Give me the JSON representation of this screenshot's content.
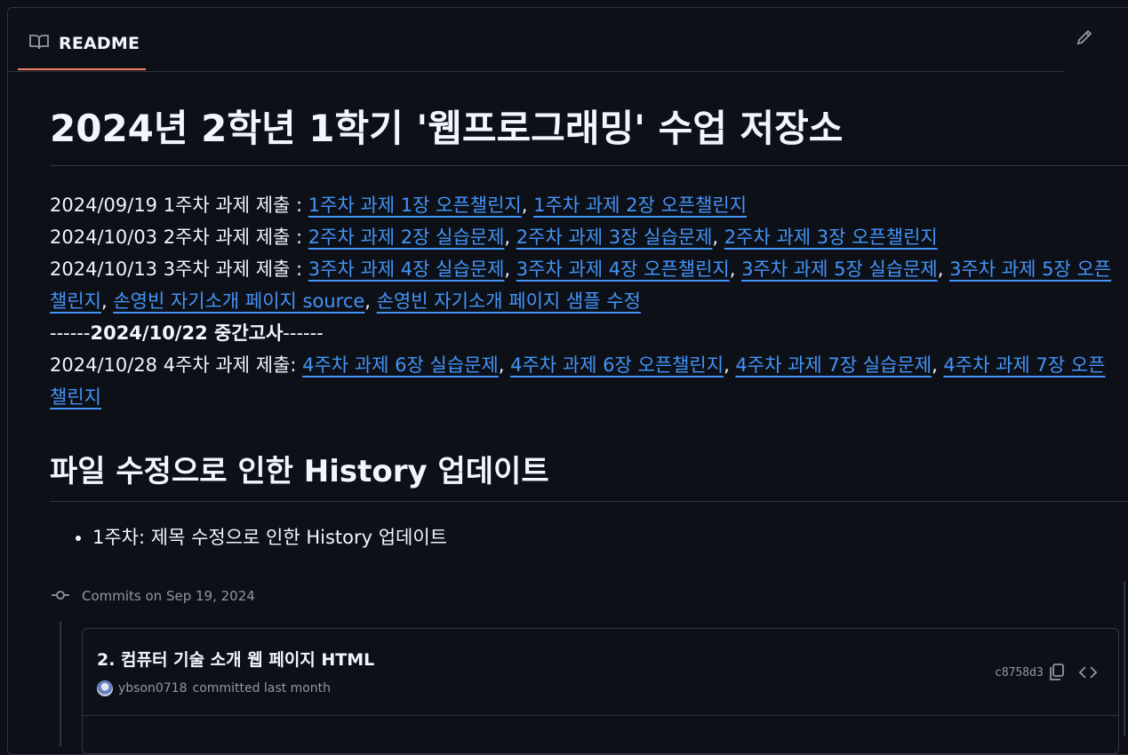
{
  "readme_tab": {
    "label": "README",
    "icon": "book-icon"
  },
  "toolbar": {
    "edit_icon": "pencil-icon",
    "more_icon": "kebab-icon"
  },
  "title": "2024년 2학년 1학기 '웹프로그래밍' 수업 저장소",
  "schedule": {
    "week1": {
      "prefix": "2024/09/19 1주차 과제 제출 : ",
      "links": [
        "1주차 과제 1장 오픈챌린지",
        "1주차 과제 2장 오픈챌린지"
      ]
    },
    "week2": {
      "prefix": "2024/10/03 2주차 과제 제출 : ",
      "links": [
        "2주차 과제 2장 실습문제",
        "2주차 과제 3장 실습문제",
        "2주차 과제 3장 오픈챌린지"
      ]
    },
    "week3": {
      "prefix": "2024/10/13 3주차 과제 제출 : ",
      "links": [
        "3주차 과제 4장 실습문제",
        "3주차 과제 4장 오픈챌린지",
        "3주차 과제 5장 실습문제",
        "3주차 과제 5장 오픈챌린지",
        "손영빈 자기소개 페이지 source",
        "손영빈 자기소개 페이지 샘플 수정"
      ]
    },
    "exam": {
      "dashes_left": "------",
      "text": "2024/10/22 중간고사",
      "dashes_right": "------"
    },
    "week4": {
      "prefix": "2024/10/28 4주차 과제 제출: ",
      "links": [
        "4주차 과제 6장 실습문제",
        "4주차 과제 6장 오픈챌린지",
        "4주차 과제 7장 실습문제",
        "4주차 과제 7장 오픈챌린지"
      ]
    },
    "separator": ", "
  },
  "history_section": {
    "title": "파일 수정으로 인한 History 업데이트",
    "items": [
      "1주차: 제목 수정으로 인한 History 업데이트"
    ]
  },
  "commits": {
    "heading": "Commits on Sep 19, 2024",
    "card": {
      "title": "2. 컴퓨터 기술 소개 웹 페이지 HTML",
      "author": "ybson0718",
      "meta": "committed last month",
      "sha": "c8758d3"
    }
  },
  "colors": {
    "link": "#4493f8",
    "accent_underline": "#f78166",
    "background": "#0d1117",
    "border": "#30363d"
  }
}
